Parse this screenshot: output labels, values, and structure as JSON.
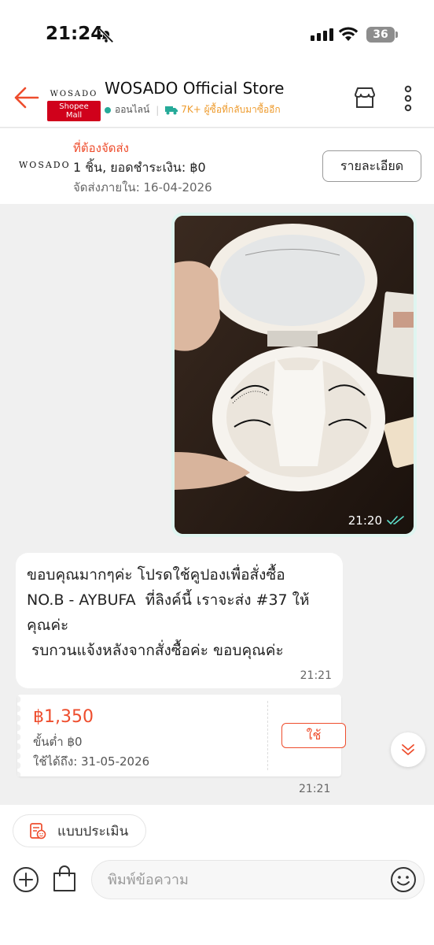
{
  "status_bar": {
    "time": "21:24",
    "battery": "36"
  },
  "header": {
    "logo_text": "WOSADO",
    "mall_badge": "Shopee Mall",
    "store_name": "WOSADO Official Store",
    "online_status": "ออนไลน์",
    "repeat_buyers": "7K+ ผู้ซื้อที่กลับมาซื้ออีก"
  },
  "order": {
    "logo_text": "WOSADO",
    "status": "ที่ต้องจัดส่ง",
    "summary": "1 ชิ้น, ยอดชำระเงิน: ฿0",
    "ship_by": "จัดส่งภายใน: 16-04-2026",
    "detail_button": "รายละเอียด"
  },
  "messages": {
    "image_time": "21:20",
    "text_lines": [
      "ขอบคุณมากๆค่ะ โปรดใช้คูปองเพื่อสั่งซื้อ",
      "NO.B - AYBUFA  ที่ลิงค์นี้ เราจะส่ง #37 ให้",
      "คุณค่ะ",
      " รบกวนแจ้งหลังจากสั่งซื้อค่ะ ขอบคุณค่ะ"
    ],
    "text_time": "21:21",
    "voucher": {
      "amount": "฿1,350",
      "min_spend": "ขั้นต่ำ ฿0",
      "valid_until": "ใช้ได้ถึง: 31-05-2026",
      "use_button": "ใช้"
    },
    "voucher_time": "21:21"
  },
  "bottom": {
    "review_label": "แบบประเมิน",
    "input_placeholder": "พิมพ์ข้อความ"
  },
  "colors": {
    "accent": "#ee4d2d",
    "online": "#26aa99",
    "repeat": "#ee9b2d",
    "image_bubble": "#dff5f0"
  }
}
